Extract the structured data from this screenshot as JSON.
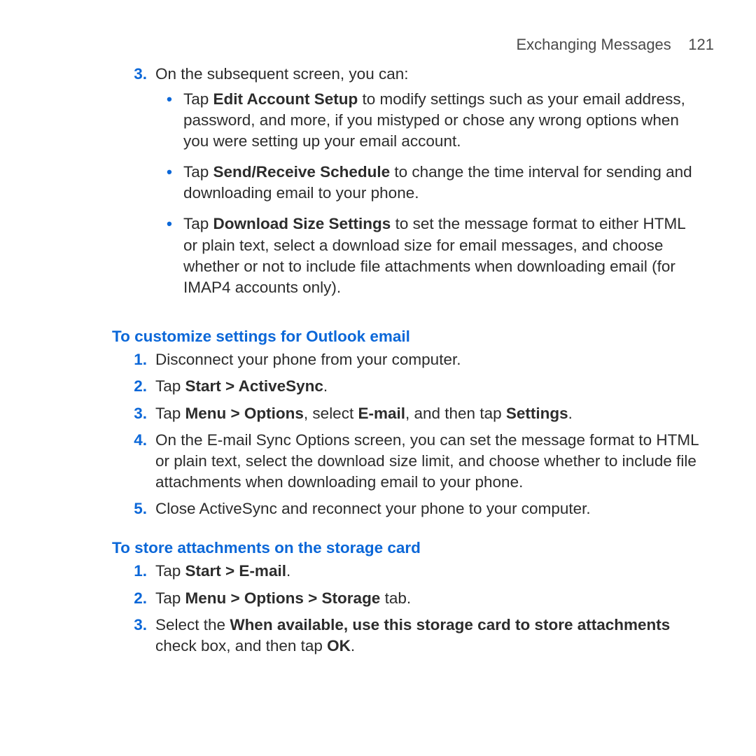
{
  "header": {
    "section": "Exchanging Messages",
    "page": "121"
  },
  "section1": {
    "step3_intro": "On the subsequent screen, you can:",
    "bullets": {
      "b1_pre": "Tap ",
      "b1_bold": "Edit Account Setup",
      "b1_post": " to modify settings such as your email address, password, and more, if you mistyped or chose any wrong options when you were setting up your email account.",
      "b2_pre": "Tap ",
      "b2_bold": "Send/Receive Schedule",
      "b2_post": " to change the time interval for sending and downloading email to your phone.",
      "b3_pre": "Tap ",
      "b3_bold": "Download Size Settings",
      "b3_post": " to set the message format to either HTML or plain text, select a download size for email messages, and choose whether or not to include file attachments when downloading email (for IMAP4 accounts only)."
    }
  },
  "section2": {
    "heading": "To customize settings for Outlook email",
    "steps": {
      "s1": "Disconnect your phone from your computer.",
      "s2_pre": "Tap ",
      "s2_bold": "Start > ActiveSync",
      "s2_post": ".",
      "s3_pre": "Tap ",
      "s3_b1": "Menu > Options",
      "s3_mid1": ", select ",
      "s3_b2": "E-mail",
      "s3_mid2": ", and then tap ",
      "s3_b3": "Settings",
      "s3_post": ".",
      "s4": "On the E-mail Sync Options screen, you can set the message format to HTML or plain text, select the download size limit, and choose whether to include file attachments when downloading email to your phone.",
      "s5": "Close ActiveSync and reconnect your phone to your computer."
    }
  },
  "section3": {
    "heading": "To store attachments on the storage card",
    "steps": {
      "s1_pre": "Tap ",
      "s1_bold": "Start > E-mail",
      "s1_post": ".",
      "s2_pre": "Tap ",
      "s2_bold": "Menu > Options > Storage",
      "s2_post": " tab.",
      "s3_pre": "Select the ",
      "s3_bold": "When available, use this storage card to store attachments",
      "s3_mid": " check box, and then tap ",
      "s3_b2": "OK",
      "s3_post": "."
    }
  },
  "nums": {
    "n1": "1.",
    "n2": "2.",
    "n3": "3.",
    "n4": "4.",
    "n5": "5."
  },
  "dot": "•"
}
